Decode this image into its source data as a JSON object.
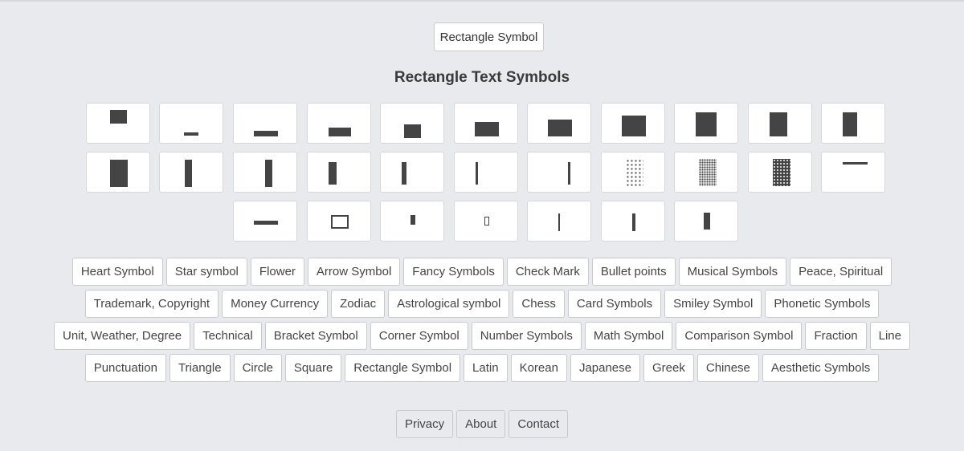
{
  "top_button": "Rectangle Symbol",
  "title": "Rectangle Text Symbols",
  "symbols": [
    {
      "name": "rect-symbol-1"
    },
    {
      "name": "rect-symbol-2"
    },
    {
      "name": "rect-symbol-3"
    },
    {
      "name": "rect-symbol-4"
    },
    {
      "name": "rect-symbol-5"
    },
    {
      "name": "rect-symbol-6"
    },
    {
      "name": "rect-symbol-7"
    },
    {
      "name": "rect-symbol-8"
    },
    {
      "name": "rect-symbol-9"
    },
    {
      "name": "rect-symbol-10"
    },
    {
      "name": "rect-symbol-11"
    },
    {
      "name": "rect-symbol-12"
    },
    {
      "name": "rect-symbol-13"
    },
    {
      "name": "rect-symbol-14"
    },
    {
      "name": "rect-symbol-15"
    },
    {
      "name": "rect-symbol-16"
    },
    {
      "name": "rect-symbol-17"
    },
    {
      "name": "rect-symbol-18"
    },
    {
      "name": "rect-symbol-19"
    },
    {
      "name": "rect-symbol-20"
    },
    {
      "name": "rect-symbol-21"
    },
    {
      "name": "rect-symbol-22"
    },
    {
      "name": "rect-symbol-23"
    },
    {
      "name": "rect-symbol-24"
    },
    {
      "name": "rect-symbol-25"
    },
    {
      "name": "rect-symbol-26"
    },
    {
      "name": "rect-symbol-27"
    },
    {
      "name": "rect-symbol-28"
    },
    {
      "name": "rect-symbol-29"
    }
  ],
  "category_rows": [
    [
      "Heart Symbol",
      "Star symbol",
      "Flower",
      "Arrow Symbol",
      "Fancy Symbols",
      "Check Mark",
      "Bullet points",
      "Musical Symbols",
      "Peace, Spiritual"
    ],
    [
      "Trademark, Copyright",
      "Money Currency",
      "Zodiac",
      "Astrological symbol",
      "Chess",
      "Card Symbols",
      "Smiley Symbol",
      "Phonetic Symbols"
    ],
    [
      "Unit, Weather, Degree",
      "Technical",
      "Bracket Symbol",
      "Corner Symbol",
      "Number Symbols",
      "Math Symbol",
      "Comparison Symbol",
      "Fraction",
      "Line"
    ],
    [
      "Punctuation",
      "Triangle",
      "Circle",
      "Square",
      "Rectangle Symbol",
      "Latin",
      "Korean",
      "Japanese",
      "Greek",
      "Chinese",
      "Aesthetic Symbols"
    ]
  ],
  "footer": [
    "Privacy",
    "About",
    "Contact"
  ],
  "colors": {
    "background": "#e9eaee",
    "symbol": "#444444"
  }
}
